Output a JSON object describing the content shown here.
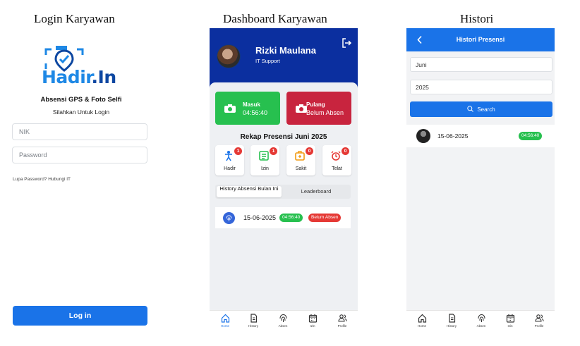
{
  "captions": {
    "login": "Login Karyawan",
    "dashboard": "Dashboard Karyawan",
    "histori": "Histori"
  },
  "login": {
    "logo_text_main": "Hadir",
    "logo_text_suffix": ".In",
    "subtitle": "Absensi GPS & Foto Selfi",
    "prompt": "Silahkan Untuk Login",
    "nik_placeholder": "NIK",
    "password_placeholder": "Password",
    "forgot_text": "Lupa Password? Hubungi IT",
    "login_button": "Log in",
    "brand_color": "#1a73e8"
  },
  "dashboard": {
    "user": {
      "name": "Rizki Maulana",
      "role": "IT Support"
    },
    "masuk": {
      "label": "Masuk",
      "value": "04:56:40",
      "color": "#27c04f"
    },
    "pulang": {
      "label": "Pulang",
      "value": "Belum Absen",
      "color": "#c8243e"
    },
    "rekap_title": "Rekap Presensi Juni 2025",
    "stats": [
      {
        "label": "Hadir",
        "count": "1",
        "icon": "person-icon"
      },
      {
        "label": "Izin",
        "count": "1",
        "icon": "document-icon"
      },
      {
        "label": "Sakit",
        "count": "0",
        "icon": "medical-kit-icon"
      },
      {
        "label": "Telat",
        "count": "0",
        "icon": "alarm-icon"
      }
    ],
    "tabs": {
      "history": "History Absensi Bulan Ini",
      "leaderboard": "Leaderboard"
    },
    "history_row": {
      "date": "15-06-2025",
      "in_time": "04:56:40",
      "out_status": "Belum Absen"
    }
  },
  "nav": {
    "home": "Home",
    "history": "History",
    "absen": "Absen",
    "izin": "Izin",
    "profile": "Profile"
  },
  "histori": {
    "title": "Histori Presensi",
    "month_value": "Juni",
    "year_value": "2025",
    "search_button": "Search",
    "row": {
      "date": "15-06-2025",
      "time": "04:56:40"
    }
  }
}
